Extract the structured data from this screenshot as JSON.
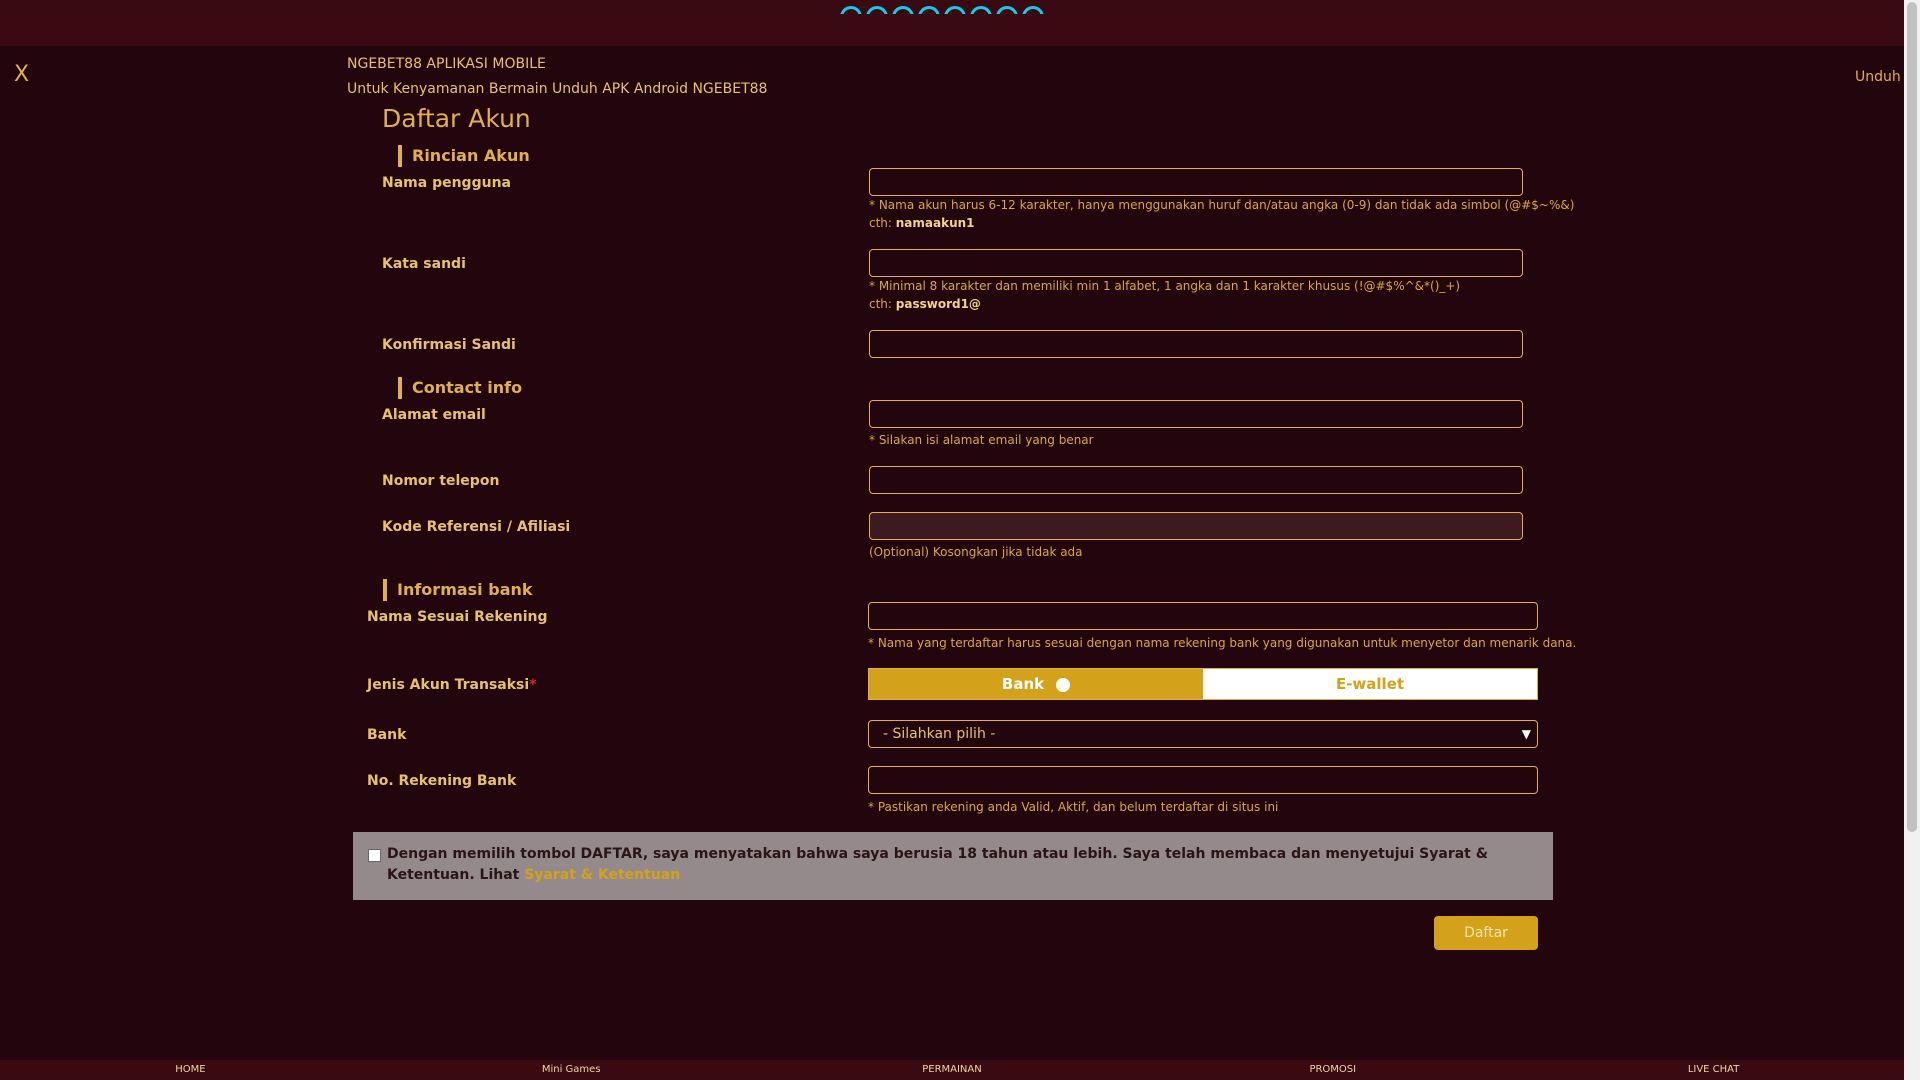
{
  "banner": {
    "close_label": "X",
    "title": "NGEBET88 APLIKASI MOBILE",
    "subtitle": "Untuk Kenyamanan Bermain Unduh APK Android NGEBET88",
    "download_label": "Unduh"
  },
  "page": {
    "title": "Daftar Akun"
  },
  "sections": {
    "account": "Rincian Akun",
    "contact": "Contact info",
    "bank": "Informasi bank"
  },
  "fields": {
    "username": {
      "label": "Nama pengguna",
      "value": "",
      "hint": "* Nama akun harus 6-12 karakter, hanya menggunakan huruf dan/atau angka (0-9) dan tidak ada simbol (@#$~%&)",
      "example_prefix": "cth: ",
      "example": "namaakun1"
    },
    "password": {
      "label": "Kata sandi",
      "value": "",
      "hint": "* Minimal 8 karakter dan memiliki min 1 alfabet, 1 angka dan 1 karakter khusus (!@#$%^&*()_+)",
      "example_prefix": "cth: ",
      "example": "password1@"
    },
    "confirm_password": {
      "label": "Konfirmasi Sandi",
      "value": ""
    },
    "email": {
      "label": "Alamat email",
      "value": "",
      "hint": "* Silakan isi alamat email yang benar"
    },
    "phone": {
      "label": "Nomor telepon",
      "value": ""
    },
    "referral": {
      "label": "Kode Referensi / Afiliasi",
      "value": "",
      "hint": "(Optional) Kosongkan jika tidak ada"
    },
    "account_name": {
      "label": "Nama Sesuai Rekening",
      "value": "",
      "hint": "* Nama yang terdaftar harus sesuai dengan nama rekening bank yang digunakan untuk menyetor dan menarik dana."
    },
    "transaction_type": {
      "label": "Jenis Akun Transaksi",
      "required_mark": "*",
      "options": [
        "Bank",
        "E-wallet"
      ],
      "selected": "Bank"
    },
    "bank": {
      "label": "Bank",
      "selected": "- Silahkan pilih -"
    },
    "account_number": {
      "label": "No. Rekening Bank",
      "value": "",
      "hint": "* Pastikan rekening anda Valid, Aktif, dan belum terdaftar di situs ini"
    }
  },
  "agreement": {
    "text": "Dengan memilih tombol DAFTAR, saya menyatakan bahwa saya berusia 18 tahun atau lebih. Saya telah membaca dan menyetujui Syarat & Ketentuan. Lihat ",
    "link": "Syarat & Ketentuan",
    "checked": false
  },
  "submit_label": "Daftar",
  "bottom_nav": [
    "HOME",
    "Mini Games",
    "PERMAINAN",
    "PROMOSI",
    "LIVE CHAT"
  ],
  "colors": {
    "background": "#23050d",
    "accent": "#e0b04d",
    "button": "#d4a21a",
    "header": "#390a12"
  }
}
